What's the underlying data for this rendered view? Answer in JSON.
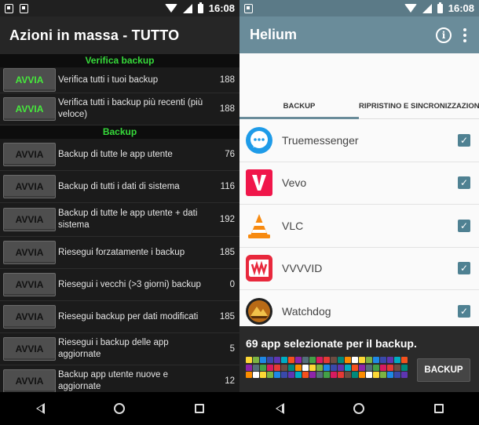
{
  "left": {
    "status_bar": {
      "time": "16:08"
    },
    "title": "Azioni in massa - TUTTO",
    "sections": [
      {
        "header": "Verifica backup",
        "rows": [
          {
            "button": "AVVIA",
            "label": "Verifica tutti i tuoi backup",
            "count": "188"
          },
          {
            "button": "AVVIA",
            "label": "Verifica tutti i backup più recenti (più veloce)",
            "count": "188"
          }
        ]
      },
      {
        "header": "Backup",
        "rows": [
          {
            "button": "AVVIA",
            "label": "Backup di tutte le app utente",
            "count": "76"
          },
          {
            "button": "AVVIA",
            "label": "Backup di tutti i dati di sistema",
            "count": "116"
          },
          {
            "button": "AVVIA",
            "label": "Backup di tutte le app utente + dati sistema",
            "count": "192"
          },
          {
            "button": "AVVIA",
            "label": "Riesegui forzatamente i backup",
            "count": "185"
          },
          {
            "button": "AVVIA",
            "label": "Riesegui i vecchi (>3 giorni) backup",
            "count": "0"
          },
          {
            "button": "AVVIA",
            "label": "Riesegui backup per dati modificati",
            "count": "185"
          },
          {
            "button": "AVVIA",
            "label": "Riesegui i backup delle app aggiornate",
            "count": "5"
          },
          {
            "button": "AVVIA",
            "label": "Backup app utente nuove e aggiornate",
            "count": "12"
          }
        ]
      }
    ]
  },
  "right": {
    "status_bar": {
      "time": "16:08"
    },
    "title": "Helium",
    "info_icon": "info-icon",
    "more_icon": "more-vert-icon",
    "tabs": [
      "BACKUP",
      "RIPRISTINO E SINCRONIZZAZIONE"
    ],
    "apps": [
      {
        "name": "Truemessenger",
        "icon": "truemessenger-icon",
        "checked": true,
        "color": "#1e9be8"
      },
      {
        "name": "Vevo",
        "icon": "vevo-icon",
        "checked": true,
        "color": "#f0164a"
      },
      {
        "name": "VLC",
        "icon": "vlc-cone-icon",
        "checked": true,
        "color": "#f78a10"
      },
      {
        "name": "VVVVID",
        "icon": "vvvvid-icon",
        "checked": true,
        "color": "#e8283c"
      },
      {
        "name": "Watchdog",
        "icon": "watchdog-icon",
        "checked": true,
        "color": "#b86a16"
      }
    ],
    "footer": {
      "summary": "69 app selezionate per il backup.",
      "button": "BACKUP"
    },
    "accent": "#6a8c9a",
    "checkbox_color": "#4f8192"
  }
}
